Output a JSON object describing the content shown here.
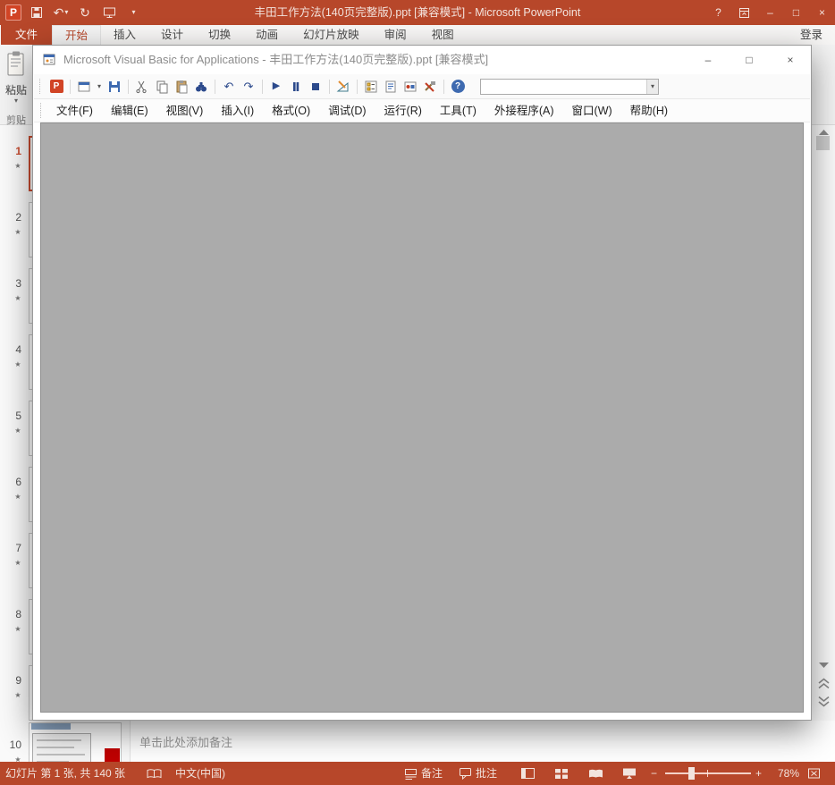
{
  "titlebar": {
    "title": "丰田工作方法(140页完整版).ppt [兼容模式] - Microsoft PowerPoint"
  },
  "ribbon": {
    "tabs": [
      {
        "label": "文件"
      },
      {
        "label": "开始"
      },
      {
        "label": "插入"
      },
      {
        "label": "设计"
      },
      {
        "label": "切换"
      },
      {
        "label": "动画"
      },
      {
        "label": "幻灯片放映"
      },
      {
        "label": "审阅"
      },
      {
        "label": "视图"
      }
    ],
    "signin": "登录",
    "paste_label": "粘贴",
    "clipboard_group_label": "剪贴"
  },
  "slide_panel": {
    "items": [
      {
        "n": "1"
      },
      {
        "n": "2"
      },
      {
        "n": "3"
      },
      {
        "n": "4"
      },
      {
        "n": "5"
      },
      {
        "n": "6"
      },
      {
        "n": "7"
      },
      {
        "n": "8"
      },
      {
        "n": "9"
      },
      {
        "n": "10"
      }
    ]
  },
  "vba": {
    "title": "Microsoft Visual Basic for Applications - 丰田工作方法(140页完整版).ppt [兼容模式]",
    "menus": [
      {
        "label": "文件(F)"
      },
      {
        "label": "编辑(E)"
      },
      {
        "label": "视图(V)"
      },
      {
        "label": "插入(I)"
      },
      {
        "label": "格式(O)"
      },
      {
        "label": "调试(D)"
      },
      {
        "label": "运行(R)"
      },
      {
        "label": "工具(T)"
      },
      {
        "label": "外接程序(A)"
      },
      {
        "label": "窗口(W)"
      },
      {
        "label": "帮助(H)"
      }
    ],
    "toolbar_field_value": ""
  },
  "notes": {
    "placeholder": "单击此处添加备注"
  },
  "statusbar": {
    "slide_info": "幻灯片 第 1 张, 共 140 张",
    "language": "中文(中国)",
    "notes_label": "备注",
    "comments_label": "批注",
    "zoom_level": "78%"
  },
  "icons": {
    "pp_logo": "P",
    "help": "?",
    "minimize": "–",
    "maximize": "□",
    "close": "×",
    "dropdown": "▾",
    "undo": "↶",
    "redo": "↷",
    "repeat": "↻",
    "run": "▶",
    "star": "★",
    "zoom_out": "−",
    "zoom_in": "+"
  },
  "colors": {
    "accent": "#B7472A",
    "vba_client_gray": "#ABABAB",
    "selected_slide": "#C84B2F"
  }
}
